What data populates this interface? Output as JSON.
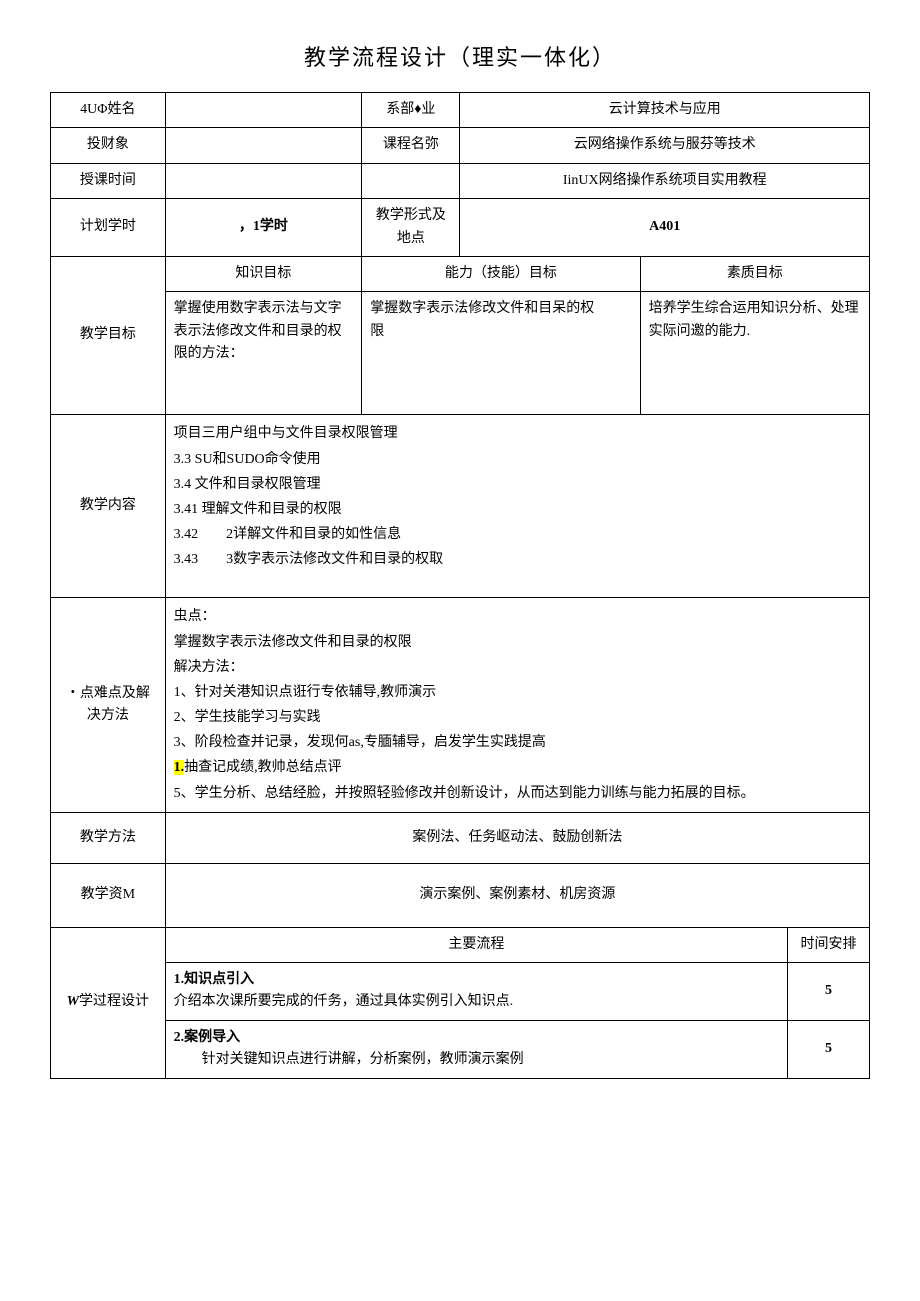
{
  "title": "教学流程设计（理实一体化）",
  "rows": {
    "r1": {
      "label": "4UΦ姓名",
      "v1": "",
      "label2": "系部♦业",
      "v2": "云计算技术与应用"
    },
    "r2": {
      "label": "投财象",
      "v1": "",
      "label2": "课程名弥",
      "v2": "云网络操作系统与服芬等技术"
    },
    "r3": {
      "label": "授课时间",
      "v1": "",
      "label2": "",
      "v2": "IinUX网络操作作系统项目实用教程"
    },
    "r3alt": {
      "v2": "IinUX网络操作系统项目实用教程"
    },
    "r4": {
      "label": "计划学时",
      "v1": "，1学时",
      "label2": "教学形式及地点",
      "v2": "A401"
    },
    "goals": {
      "label": "教学目标",
      "col1h": "知识目标",
      "col2h": "能力（技能）目标",
      "col3h": "素质目标",
      "col1": "掌握使用数字表示法与文字表示法修改文件和目录的权限的方法：",
      "col2": "掌握数字表示法修改文件和目呆的权\n限",
      "col3": "培养学生综合运用知识分析、处理实际问邀的能力."
    },
    "content": {
      "label": "教学内容",
      "body": "项目三用户组中与文件目录权限管理\n3.3 SU和SUDO命令使用\n3.4 文件和目录权限管理\n3.41 理解文件和目录的权限\n3.42　　2详解文件和目录的如性信息\n3.43　　3数字表示法修改文件和目录的权取"
    },
    "difficulty": {
      "label": "・点难点及解决方法",
      "pre": "虫点：\n掌握数字表示法修改文件和目录的权限\n解决方法：\n1、针对关港知识点诳行专依辅导,教师演示\n2、学生技能学习与实践\n3、阶段检查并记录，发现何as,专腼辅导，启发学生实践提高",
      "hl": "1.",
      "afterhl": "抽查记成绩,教帅总结点评",
      "post": "5、学生分析、总结经脸，并按照轻验修改并创新设计，从而达到能力训练与能力拓展的目标。"
    },
    "method": {
      "label": "教学方法",
      "value": "案例法、任务岖动法、鼓励创新法"
    },
    "resource": {
      "label": "教学资M",
      "value": "演示案例、案例素材、机房资源"
    },
    "process": {
      "label": "W学过程设计",
      "mainflow": "主要流程",
      "time": "时间安排",
      "step1": {
        "title": "1.知识点引入",
        "body": "介绍本次课所要完成的仟务，通过具体实例引入知识点.",
        "t": "5"
      },
      "step2": {
        "title": "2.案例导入",
        "body": "　　针对关键知识点进行讲解，分析案例，教师演示案例",
        "t": "5"
      }
    }
  }
}
